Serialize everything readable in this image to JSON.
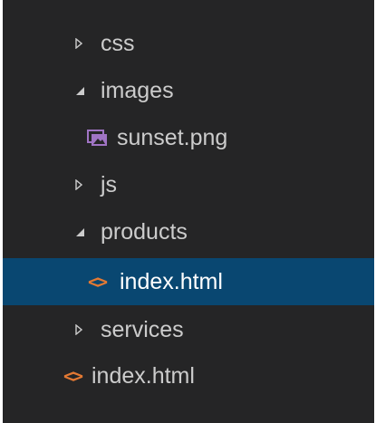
{
  "explorer": {
    "items": [
      {
        "label": "css",
        "icon": "chevron-right-icon",
        "expanded": false
      },
      {
        "label": "images",
        "icon": "chevron-down-icon",
        "expanded": true
      },
      {
        "label": "sunset.png",
        "icon": "image-file-icon"
      },
      {
        "label": "js",
        "icon": "chevron-right-icon",
        "expanded": false
      },
      {
        "label": "products",
        "icon": "chevron-down-icon",
        "expanded": true
      },
      {
        "label": "index.html",
        "icon": "html-file-icon",
        "selected": true
      },
      {
        "label": "services",
        "icon": "chevron-right-icon",
        "expanded": false
      },
      {
        "label": "index.html",
        "icon": "html-file-icon"
      }
    ],
    "html_icon_glyph": "<>"
  },
  "colors": {
    "background": "#252526",
    "text": "#cccccc",
    "selected_background": "#094771",
    "html_icon": "#e37933",
    "image_icon": "#a074c4"
  }
}
